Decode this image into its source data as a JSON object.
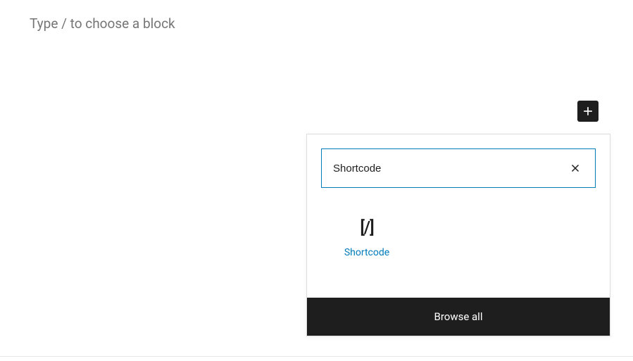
{
  "editor": {
    "placeholder": "Type / to choose a block"
  },
  "inserter": {
    "search_value": "Shortcode",
    "results": [
      {
        "icon_text": "[/]",
        "label": "Shortcode"
      }
    ],
    "browse_all_label": "Browse all"
  }
}
